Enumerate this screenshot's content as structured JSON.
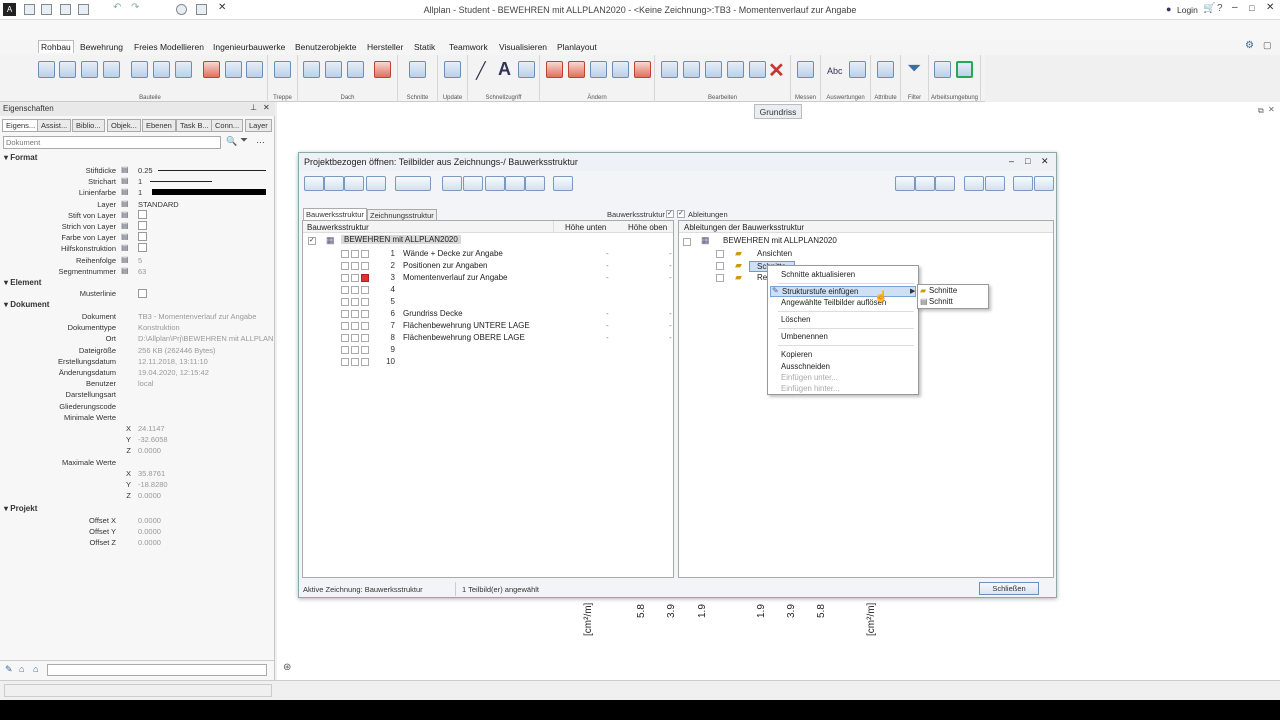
{
  "titlebar": {
    "title": "Allplan - Student - BEWEHREN mit ALLPLAN2020 - <Keine Zeichnung>:TB3 - Momentenverlauf zur Angabe",
    "login": "Login"
  },
  "ribbon": {
    "tabs": [
      "Rohbau",
      "Bewehrung",
      "Freies Modellieren",
      "Ingenieurbauwerke",
      "Benutzerobjekte",
      "Hersteller",
      "Statik",
      "Teamwork",
      "Visualisieren",
      "Planlayout"
    ],
    "groups": [
      "Bauteile",
      "Treppe",
      "Dach",
      "Schnitte",
      "Update",
      "Schnellzugriff",
      "Ändern",
      "Bearbeiten",
      "Messen",
      "Auswertungen",
      "Attribute",
      "Filter",
      "Arbeitsumgebung"
    ]
  },
  "view_button": "Grundriss",
  "properties": {
    "title": "Eigenschaften",
    "tabs": [
      "Eigens...",
      "Assist...",
      "Biblio...",
      "Objek...",
      "Ebenen",
      "Task B...",
      "Conn...",
      "Layer"
    ],
    "search_placeholder": "Dokument",
    "sections": {
      "format": "Format",
      "element": "Element",
      "dokument": "Dokument",
      "projekt": "Projekt"
    },
    "format": [
      {
        "label": "Stiftdicke",
        "value": "0.25"
      },
      {
        "label": "Strichart",
        "value": "1"
      },
      {
        "label": "Linienfarbe",
        "value": "1"
      },
      {
        "label": "Layer",
        "value": "STANDARD"
      },
      {
        "label": "Stift von Layer",
        "value": ""
      },
      {
        "label": "Strich von Layer",
        "value": ""
      },
      {
        "label": "Farbe von Layer",
        "value": ""
      },
      {
        "label": "Hilfskonstruktion",
        "value": ""
      },
      {
        "label": "Reihenfolge",
        "value": "5"
      },
      {
        "label": "Segmentnummer",
        "value": "63"
      }
    ],
    "element": [
      {
        "label": "Musterlinie",
        "value": ""
      }
    ],
    "dokument": [
      {
        "label": "Dokument",
        "value": "TB3 - Momentenverlauf zur Angabe"
      },
      {
        "label": "Dokumenttype",
        "value": "Konstruktion"
      },
      {
        "label": "Ort",
        "value": "D:\\Allplan\\Prj\\BEWEHREN mit ALLPLAN"
      },
      {
        "label": "Dateigröße",
        "value": "256 KB (262446 Bytes)"
      },
      {
        "label": "Erstellungsdatum",
        "value": "12.11.2018, 13:11:10"
      },
      {
        "label": "Änderungsdatum",
        "value": "19.04.2020, 12:15:42"
      },
      {
        "label": "Benutzer",
        "value": "local"
      },
      {
        "label": "Darstellungsart",
        "value": ""
      },
      {
        "label": "Gliederungscode",
        "value": ""
      },
      {
        "label": "Minimale Werte",
        "value": ""
      },
      {
        "label": "X",
        "value": "24.1147"
      },
      {
        "label": "Y",
        "value": "-32.6058"
      },
      {
        "label": "Z",
        "value": "0.0000"
      },
      {
        "label": "Maximale Werte",
        "value": ""
      },
      {
        "label": "X",
        "value": "35.8761"
      },
      {
        "label": "Y",
        "value": "-18.8280"
      },
      {
        "label": "Z",
        "value": "0.0000"
      }
    ],
    "projekt": [
      {
        "label": "Offset X",
        "value": "0.0000"
      },
      {
        "label": "Offset Y",
        "value": "0.0000"
      },
      {
        "label": "Offset Z",
        "value": "0.0000"
      }
    ]
  },
  "dialog": {
    "title": "Projektbezogen öffnen: Teilbilder aus Zeichnungs-/ Bauwerksstruktur",
    "tab_bauwerk": "Bauwerksstruktur",
    "tab_zeichnung": "Zeichnungsstruktur",
    "opt_bauwerk": "Bauwerksstruktur",
    "opt_ableitungen": "Ableitungen",
    "left_header": {
      "col1": "Bauwerksstruktur",
      "col2": "Höhe unten",
      "col3": "Höhe oben"
    },
    "root": "BEWEHREN mit ALLPLAN2020",
    "rows": [
      {
        "num": "1",
        "name": "Wände + Decke zur Angabe",
        "lo": "-",
        "hi": "-"
      },
      {
        "num": "2",
        "name": "Positionen zur Angaben",
        "lo": "-",
        "hi": "-"
      },
      {
        "num": "3",
        "name": "Momentenverlauf zur Angabe",
        "lo": "-",
        "hi": "-"
      },
      {
        "num": "4",
        "name": "",
        "lo": "",
        "hi": ""
      },
      {
        "num": "5",
        "name": "",
        "lo": "",
        "hi": ""
      },
      {
        "num": "6",
        "name": "Grundriss Decke",
        "lo": "-",
        "hi": "-"
      },
      {
        "num": "7",
        "name": "Flächenbewehrung UNTERE LAGE",
        "lo": "-",
        "hi": "-"
      },
      {
        "num": "8",
        "name": "Flächenbewehrung OBERE LAGE",
        "lo": "-",
        "hi": "-"
      },
      {
        "num": "9",
        "name": "",
        "lo": "",
        "hi": ""
      },
      {
        "num": "10",
        "name": "",
        "lo": "",
        "hi": ""
      }
    ],
    "right_header": "Ableitungen der Bauwerksstruktur",
    "right_root": "BEWEHREN mit ALLPLAN2020",
    "right_items": [
      "Ansichten",
      "Schnitte",
      "Re"
    ],
    "status_left": "Aktive Zeichnung: Bauwerksstruktur",
    "status_mid": "1 Teilbild(er) angewählt",
    "close": "Schließen"
  },
  "context_menu": {
    "items": [
      "Schnitte aktualisieren",
      "Strukturstufe einfügen",
      "Angewählte Teilbilder auflösen",
      "Löschen",
      "Umbenennen",
      "Kopieren",
      "Ausschneiden",
      "Einfügen unter...",
      "Einfügen hinter..."
    ],
    "submenu": [
      "Schnitte",
      "Schnitt"
    ]
  },
  "drawing_labels": [
    "[cm²/m]",
    "5.8",
    "3.9",
    "1.9",
    "1.9",
    "3.9",
    "5.8",
    "[cm²/m]"
  ]
}
